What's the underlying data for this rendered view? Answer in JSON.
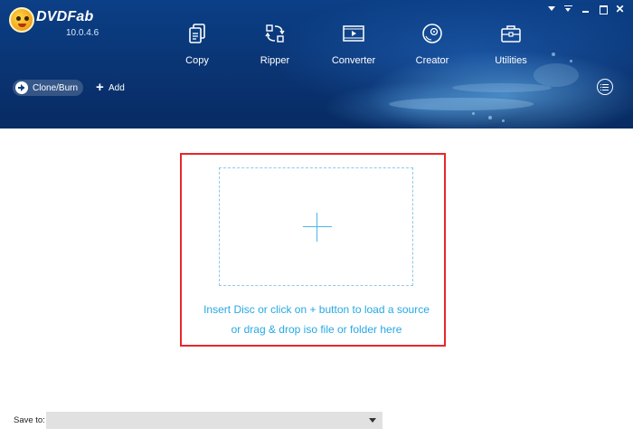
{
  "app": {
    "brand": "DVDFab",
    "version": "10.0.4.6"
  },
  "window_controls": [
    "menu-icon",
    "dropdown-icon",
    "minimize-icon",
    "maximize-icon",
    "close-icon"
  ],
  "nav": {
    "items": [
      {
        "label": "Copy",
        "icon": "copy-icon"
      },
      {
        "label": "Ripper",
        "icon": "ripper-icon"
      },
      {
        "label": "Converter",
        "icon": "converter-icon"
      },
      {
        "label": "Creator",
        "icon": "creator-icon"
      },
      {
        "label": "Utilities",
        "icon": "utilities-icon"
      }
    ]
  },
  "toolbar": {
    "mode_label": "Clone/Burn",
    "add_label": "Add"
  },
  "dropzone": {
    "line1": "Insert Disc or click on + button to load a source",
    "line2": "or drag & drop iso file or folder here"
  },
  "save": {
    "label": "Save to:",
    "value": ""
  },
  "colors": {
    "header": "#0a3473",
    "accent_text": "#27a8e2",
    "highlight_border": "#e8272b"
  }
}
